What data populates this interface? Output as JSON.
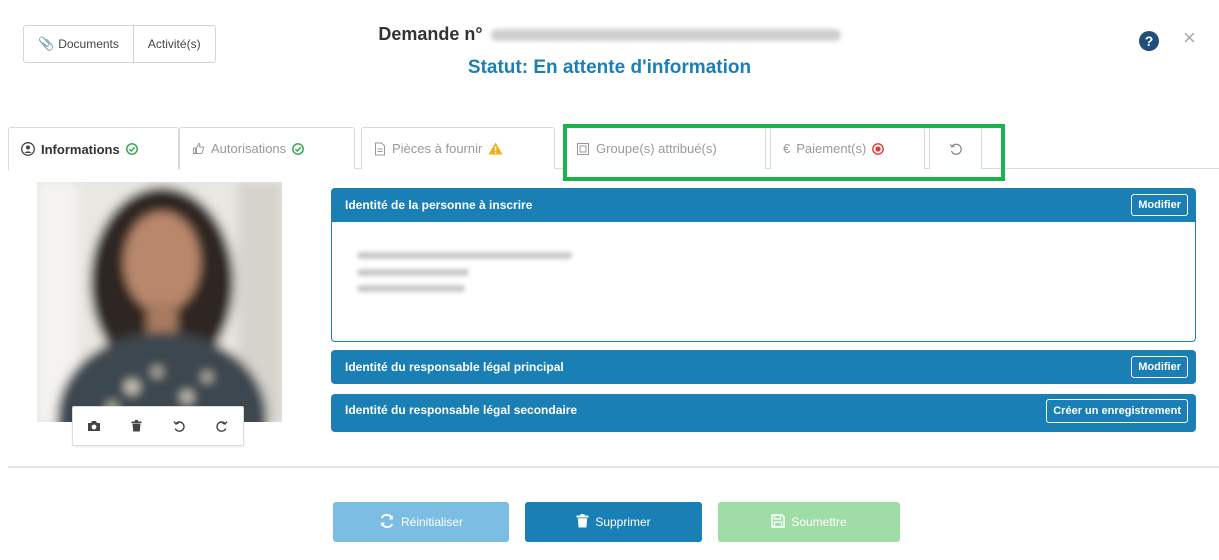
{
  "header": {
    "documents_label": "Documents",
    "activities_label": "Activité(s)",
    "title": "Demande n°",
    "status": "Statut: En attente d'information"
  },
  "tabs": [
    {
      "label": "Informations",
      "status_icon": "check-circle-icon",
      "active": true
    },
    {
      "label": "Autorisations",
      "status_icon": "check-circle-icon",
      "active": false
    },
    {
      "label": "Pièces à fournir",
      "status_icon": "warning-icon",
      "active": false
    },
    {
      "label": "Groupe(s) attribué(s)",
      "status_icon": "",
      "active": false
    },
    {
      "label": "Paiement(s)",
      "status_icon": "error-circle-icon",
      "active": false
    },
    {
      "label": "",
      "status_icon": "history-icon",
      "active": false
    }
  ],
  "panels": {
    "identity": {
      "title": "Identité de la personne à inscrire",
      "button": "Modifier"
    },
    "primary_guardian": {
      "title": "Identité du responsable légal principal",
      "button": "Modifier"
    },
    "secondary_guardian": {
      "title": "Identité du responsable légal secondaire",
      "button": "Créer un enregistrement"
    }
  },
  "photo_tools": [
    "camera-icon",
    "trash-icon",
    "rotate-left-icon",
    "rotate-right-icon"
  ],
  "actions": {
    "reset": "Réinitialiser",
    "delete": "Supprimer",
    "submit": "Soumettre"
  },
  "colors": {
    "primary": "#1a7fb5",
    "status_text": "#1a7fb5",
    "success": "#2aa54a",
    "warning": "#f0ad1c",
    "danger": "#e53935",
    "highlight": "#1db34c",
    "reset_button": "#7cbde3",
    "delete_button": "#1a7fb5",
    "submit_button": "#9fdca6"
  }
}
